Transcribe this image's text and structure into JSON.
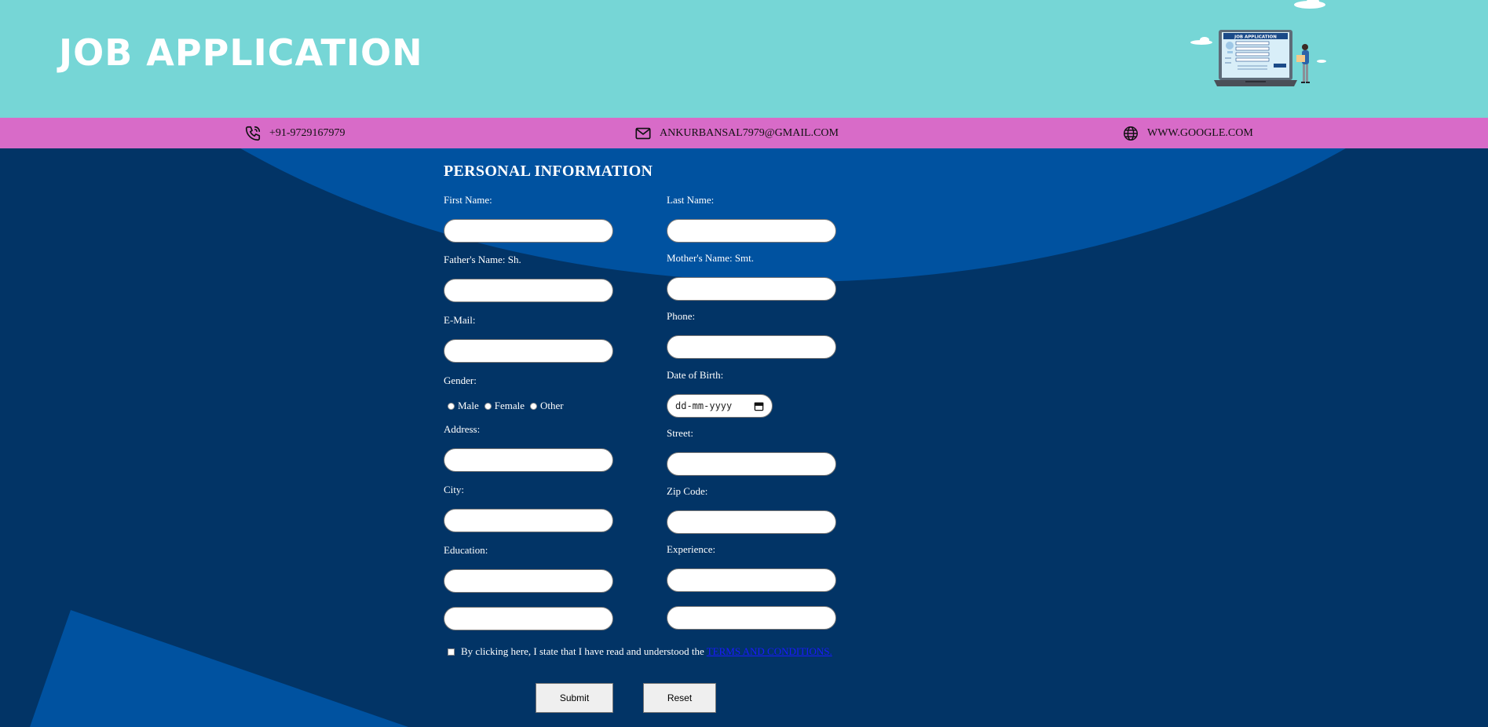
{
  "header": {
    "title": "JOB APPLICATION",
    "illustration_label": "JOB APPLICATION",
    "background_color": "#76d6d6"
  },
  "contact_bar": {
    "background_color": "#d86bc8",
    "phone": {
      "icon": "phone-icon",
      "text": "+91-9729167979"
    },
    "email": {
      "icon": "mail-icon",
      "text": "ANKURBANSAL7979@GMAIL.COM"
    },
    "website": {
      "icon": "globe-icon",
      "text": "WWW.GOOGLE.COM"
    }
  },
  "form": {
    "section_title": "PERSONAL INFORMATION",
    "labels": {
      "first_name": "First Name:",
      "last_name": "Last Name:",
      "father_name": "Father's Name: Sh.",
      "mother_name": "Mother's Name: Smt.",
      "email": "E-Mail:",
      "phone": "Phone:",
      "gender": "Gender:",
      "dob": "Date of Birth:",
      "address": "Address:",
      "street": "Street:",
      "city": "City:",
      "zip": "Zip Code:",
      "education": "Education:",
      "experience": "Experience:"
    },
    "gender_options": [
      "Male",
      "Female",
      "Other"
    ],
    "dob_placeholder": "dd-mm-yyyy",
    "terms_text": "By clicking here, I state that I have read and understood the",
    "terms_link": "TERMS AND CONDITIONS.",
    "submit_label": "Submit",
    "reset_label": "Reset"
  },
  "colors": {
    "background_dark": "#023466",
    "background_light": "#0052a0",
    "link": "#1a1aff"
  }
}
